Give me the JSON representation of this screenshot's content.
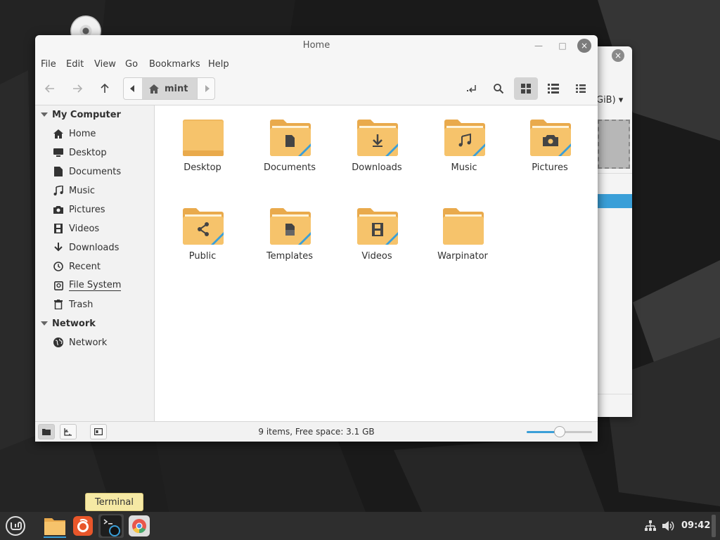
{
  "desktop": {
    "disc_icon": "disc-icon"
  },
  "background_window": {
    "size_text": "GiB) ▾",
    "close": "×"
  },
  "window": {
    "title": "Home",
    "buttons": {
      "minimize": "—",
      "maximize": "□",
      "close": "×"
    }
  },
  "menubar": [
    "File",
    "Edit",
    "View",
    "Go",
    "Bookmarks",
    "Help"
  ],
  "toolbar": {
    "path_segment": "mint",
    "icons": [
      "back-arrow-icon",
      "forward-arrow-icon",
      "up-arrow-icon",
      "toggle-location-icon",
      "search-icon",
      "icon-view-icon",
      "list-view-icon",
      "compact-view-icon"
    ]
  },
  "sidebar": {
    "sections": [
      {
        "header": "My Computer",
        "items": [
          {
            "label": "Home",
            "icon": "home-icon"
          },
          {
            "label": "Desktop",
            "icon": "desktop-icon"
          },
          {
            "label": "Documents",
            "icon": "document-icon"
          },
          {
            "label": "Music",
            "icon": "music-icon"
          },
          {
            "label": "Pictures",
            "icon": "camera-icon"
          },
          {
            "label": "Videos",
            "icon": "film-icon"
          },
          {
            "label": "Downloads",
            "icon": "download-icon"
          },
          {
            "label": "Recent",
            "icon": "clock-icon"
          },
          {
            "label": "File System",
            "icon": "drive-icon"
          },
          {
            "label": "Trash",
            "icon": "trash-icon"
          }
        ]
      },
      {
        "header": "Network",
        "items": [
          {
            "label": "Network",
            "icon": "globe-icon"
          }
        ]
      }
    ]
  },
  "files": [
    {
      "name": "Desktop",
      "emblem": "none"
    },
    {
      "name": "Documents",
      "emblem": "document"
    },
    {
      "name": "Downloads",
      "emblem": "download"
    },
    {
      "name": "Music",
      "emblem": "music"
    },
    {
      "name": "Pictures",
      "emblem": "camera"
    },
    {
      "name": "Public",
      "emblem": "share"
    },
    {
      "name": "Templates",
      "emblem": "template"
    },
    {
      "name": "Videos",
      "emblem": "film"
    },
    {
      "name": "Warpinator",
      "emblem": "none"
    }
  ],
  "statusbar": {
    "text": "9 items, Free space: 3.1 GB",
    "zoom_level": 0.5
  },
  "taskbar": {
    "tooltip": "Terminal",
    "apps": [
      "menu-icon",
      "files-icon",
      "firefox-icon",
      "terminal-icon",
      "chromium-icon"
    ],
    "clock": "09:42",
    "tray": [
      "network-icon",
      "volume-icon"
    ]
  },
  "colors": {
    "folder": "#f6c36b",
    "folder_dark": "#e9aa4c",
    "accent": "#3a9fd8",
    "taskbar": "#2e2e2e"
  }
}
